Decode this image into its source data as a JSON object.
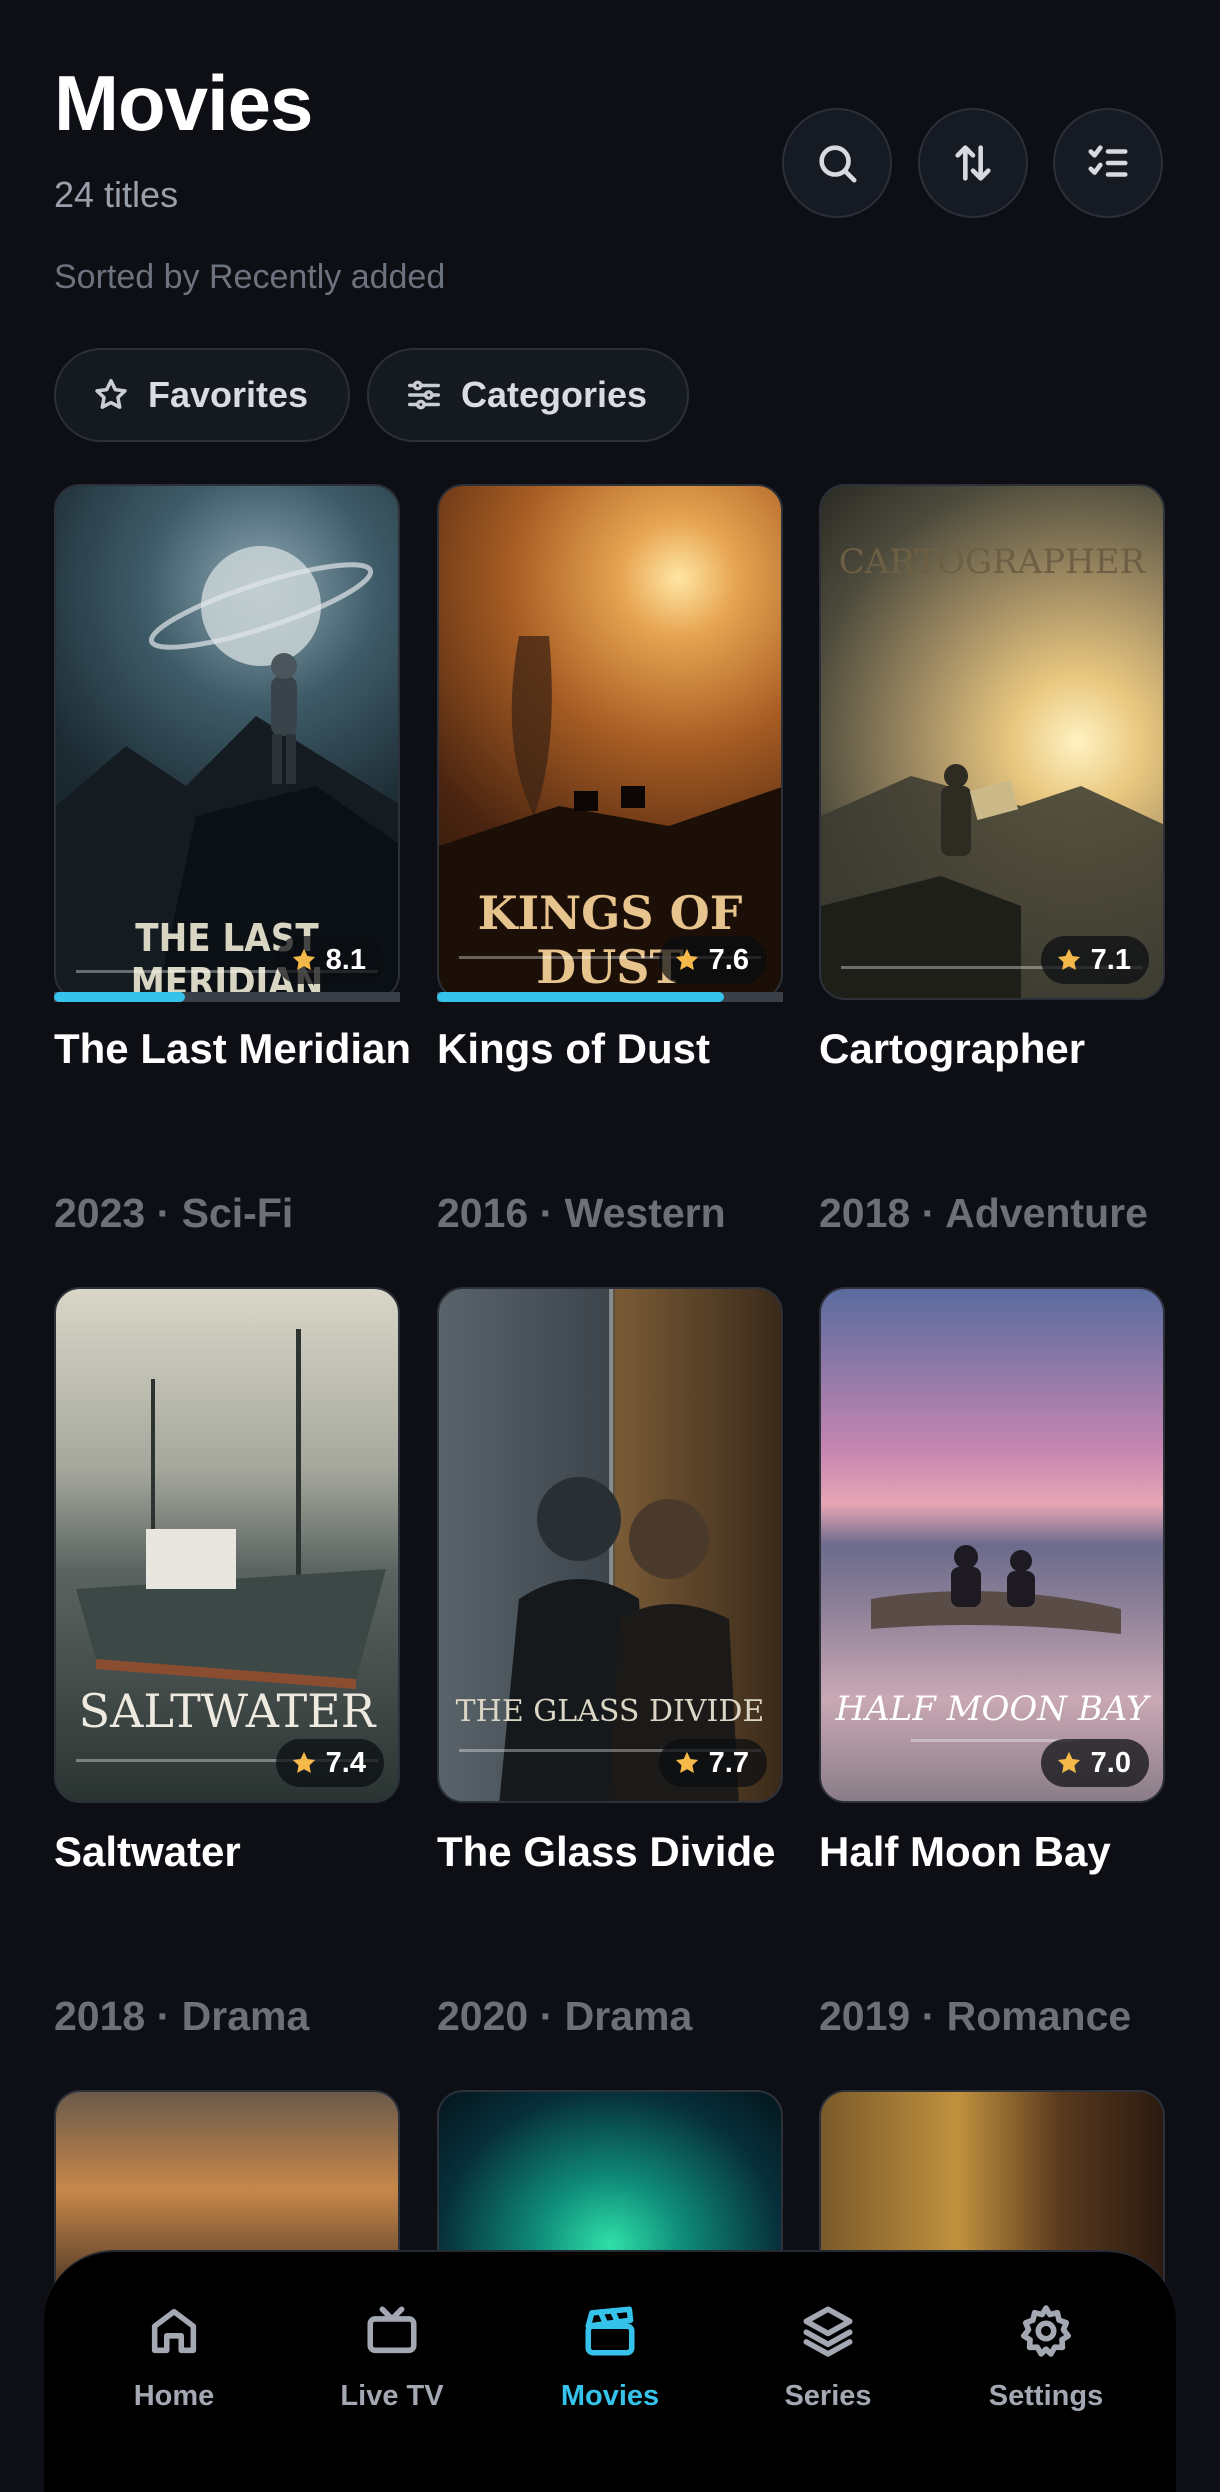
{
  "header": {
    "title": "Movies",
    "count": "24 titles",
    "sort_label": "Sorted by Recently added",
    "actions": [
      "search-icon",
      "sort-icon",
      "checklist-icon"
    ]
  },
  "filters": {
    "favorites_label": "Favorites",
    "categories_label": "Categories"
  },
  "movies": [
    {
      "title": "The Last Meridian",
      "poster_text": "THE LAST MERIDIAN",
      "rating": "8.1",
      "meta": "2023 · Sci-Fi",
      "progress": 0.38
    },
    {
      "title": "Kings of Dust",
      "poster_text": "KINGS OF DUST",
      "rating": "7.6",
      "meta": "2016 · Western",
      "progress": 0.83
    },
    {
      "title": "Cartographer",
      "poster_text": "CARTOGRAPHER",
      "rating": "7.1",
      "meta": "2018 · Adventure"
    },
    {
      "title": "Saltwater",
      "poster_text": "SALTWATER",
      "rating": "7.4",
      "meta": "2018 · Drama"
    },
    {
      "title": "The Glass Divide",
      "poster_text": "THE GLASS DIVIDE",
      "rating": "7.7",
      "meta": "2020 · Drama"
    },
    {
      "title": "Half Moon Bay",
      "poster_text": "HALF MOON BAY",
      "rating": "7.0",
      "meta": "2019 · Romance"
    }
  ],
  "nav": {
    "items": [
      {
        "label": "Home",
        "icon": "home-icon"
      },
      {
        "label": "Live TV",
        "icon": "tv-icon"
      },
      {
        "label": "Movies",
        "icon": "clapperboard-icon",
        "active": true
      },
      {
        "label": "Series",
        "icon": "layers-icon"
      },
      {
        "label": "Settings",
        "icon": "gear-icon"
      }
    ]
  },
  "colors": {
    "background": "#0d0f14",
    "accent": "#35c3eb",
    "star": "#f5b949",
    "muted_text": "#6b7079"
  }
}
